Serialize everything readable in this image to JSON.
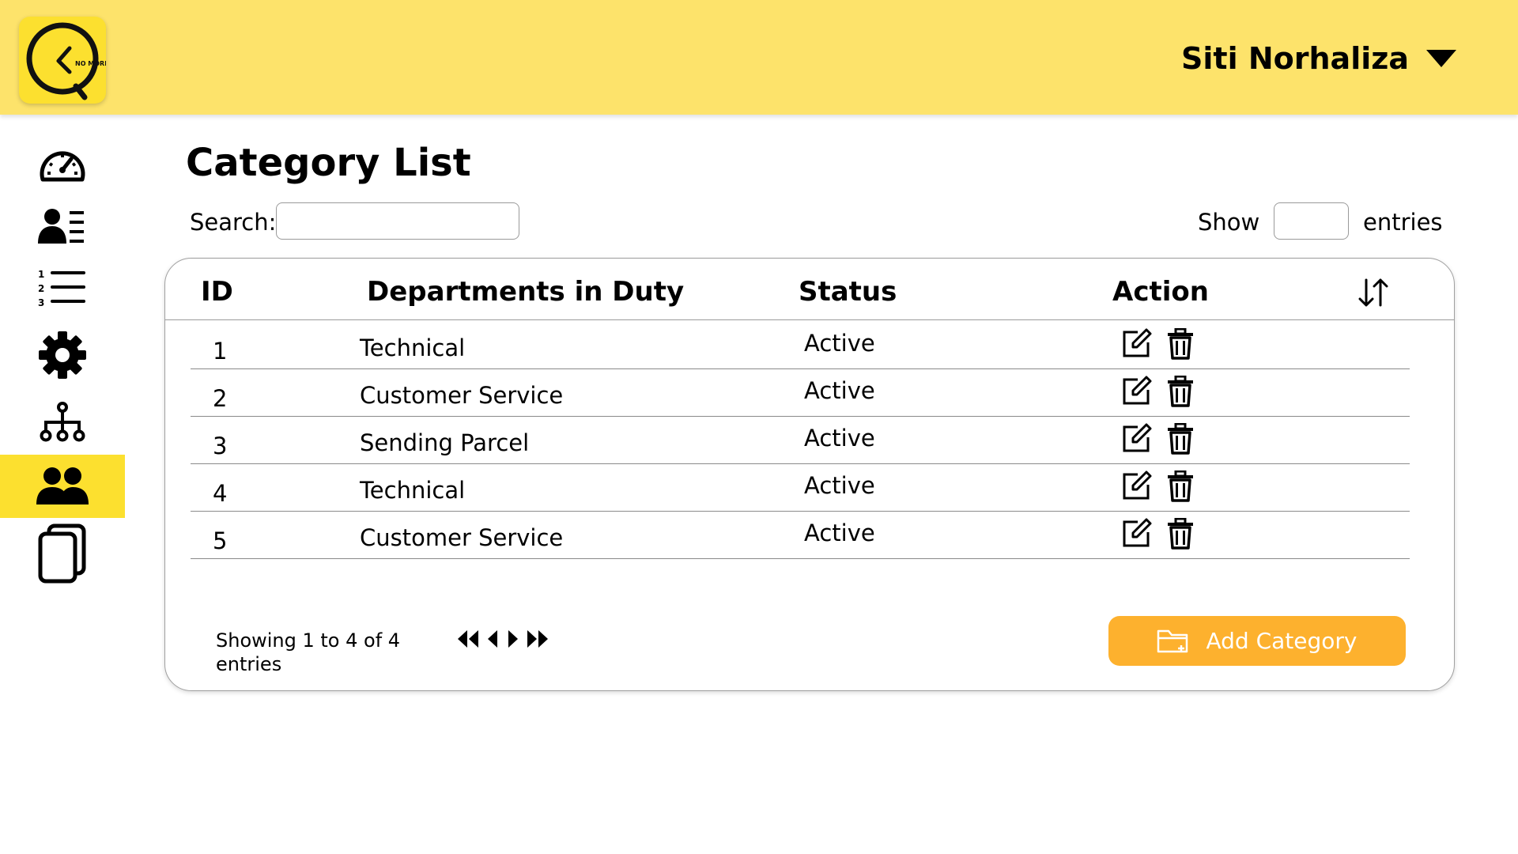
{
  "header": {
    "logo_text": "NO MORE",
    "user_name": "Siti Norhaliza"
  },
  "sidebar": {
    "items": [
      {
        "icon": "speedometer-icon",
        "active": false
      },
      {
        "icon": "user-list-icon",
        "active": false
      },
      {
        "icon": "numbered-list-icon",
        "active": false
      },
      {
        "icon": "gear-icon",
        "active": false
      },
      {
        "icon": "org-chart-icon",
        "active": false
      },
      {
        "icon": "users-icon",
        "active": true
      },
      {
        "icon": "copy-icon",
        "active": false
      }
    ]
  },
  "main": {
    "title": "Category List",
    "search_label": "Search:",
    "search_value": "",
    "show_label": "Show",
    "show_value": "",
    "entries_label": "entries"
  },
  "table": {
    "columns": [
      "ID",
      "Departments in Duty",
      "Status",
      "Action"
    ],
    "rows": [
      {
        "id": "1",
        "department": "Technical",
        "status": "Active"
      },
      {
        "id": "2",
        "department": "Customer Service",
        "status": "Active"
      },
      {
        "id": "3",
        "department": "Sending Parcel",
        "status": "Active"
      },
      {
        "id": "4",
        "department": "Technical",
        "status": "Active"
      },
      {
        "id": "5",
        "department": "Customer Service",
        "status": "Active"
      }
    ],
    "action_icons": [
      "edit-icon",
      "trash-icon"
    ]
  },
  "footer": {
    "showing_text": "Showing 1 to 4 of 4 entries",
    "pager_icons": [
      "first-page-icon",
      "prev-page-icon",
      "next-page-icon",
      "last-page-icon"
    ],
    "add_button_label": "Add Category"
  },
  "colors": {
    "topbar": "#fde36b",
    "logo_bg": "#fce02f",
    "active_sidebar": "#fce02f",
    "add_button": "#fdb12e"
  }
}
